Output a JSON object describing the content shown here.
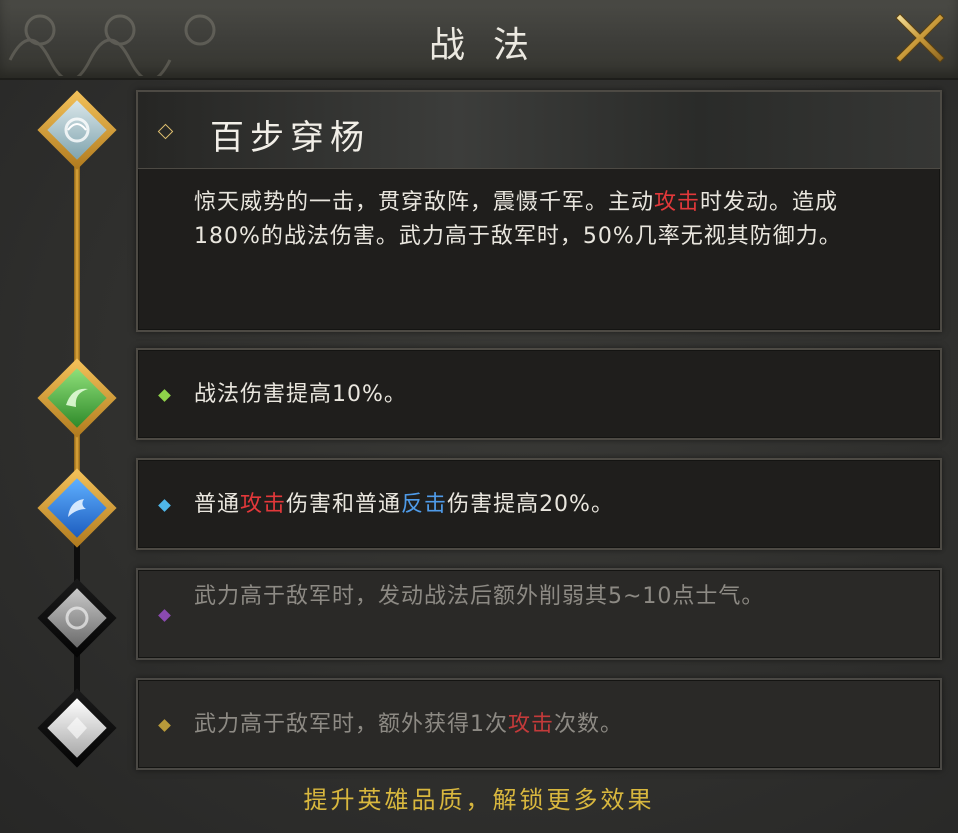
{
  "header": {
    "title": "战法"
  },
  "skill": {
    "name": "百步穿杨",
    "description": [
      {
        "t": "惊天威势的一击，贯穿敌阵，震慑千军。主动",
        "c": ""
      },
      {
        "t": "攻击",
        "c": "red"
      },
      {
        "t": "时发动。造成180%的战法伤害。武力高于敌军时，50%几率无视其防御力。",
        "c": ""
      }
    ]
  },
  "effects": [
    {
      "status": "unlocked",
      "segments": [
        {
          "t": "战法伤害提高10%。",
          "c": ""
        }
      ]
    },
    {
      "status": "unlocked",
      "segments": [
        {
          "t": "普通",
          "c": ""
        },
        {
          "t": "攻击",
          "c": "red"
        },
        {
          "t": "伤害和普通",
          "c": ""
        },
        {
          "t": "反击",
          "c": "blue"
        },
        {
          "t": "伤害提高20%。",
          "c": ""
        }
      ]
    },
    {
      "status": "locked",
      "segments": [
        {
          "t": "武力高于敌军时，发动战法后额外削弱其5~10点士气。",
          "c": ""
        }
      ]
    },
    {
      "status": "locked",
      "segments": [
        {
          "t": "武力高于敌军时，额外获得1次",
          "c": ""
        },
        {
          "t": "攻击",
          "c": "red"
        },
        {
          "t": "次数。",
          "c": ""
        }
      ]
    }
  ],
  "footer": {
    "hint": "提升英雄品质，解锁更多效果"
  },
  "colors": {
    "gold": "#e0a83a",
    "highlight_red": "#e2383a",
    "highlight_blue": "#4f9be8",
    "hint_yellow": "#d8b73e"
  },
  "icons": [
    "close-icon",
    "skill-emblem-icon",
    "green-rune-icon",
    "blue-rune-icon",
    "gray-rune-icon",
    "white-rune-icon"
  ]
}
